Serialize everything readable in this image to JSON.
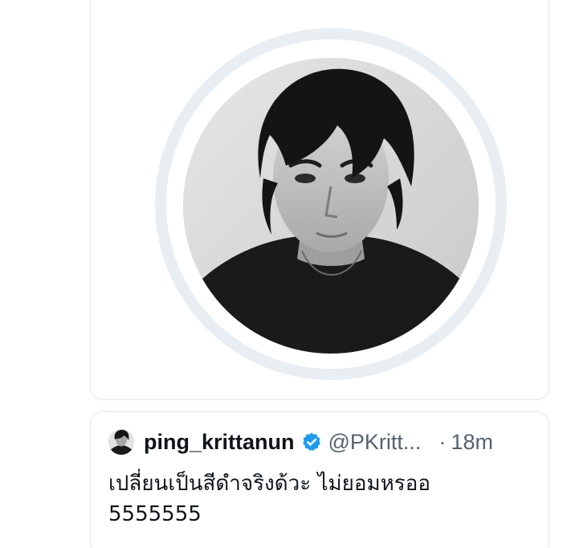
{
  "media": {
    "icon": "profile-photo"
  },
  "quote": {
    "display_name": "ping_krittanun",
    "handle": "@PKritt...",
    "separator": "·",
    "time": "18m",
    "text": "เปลี่ยนเป็นสีดำจริงด้วะ ไม่ยอมหรออ\n5555555",
    "verified_color": "#1d9bf0"
  }
}
